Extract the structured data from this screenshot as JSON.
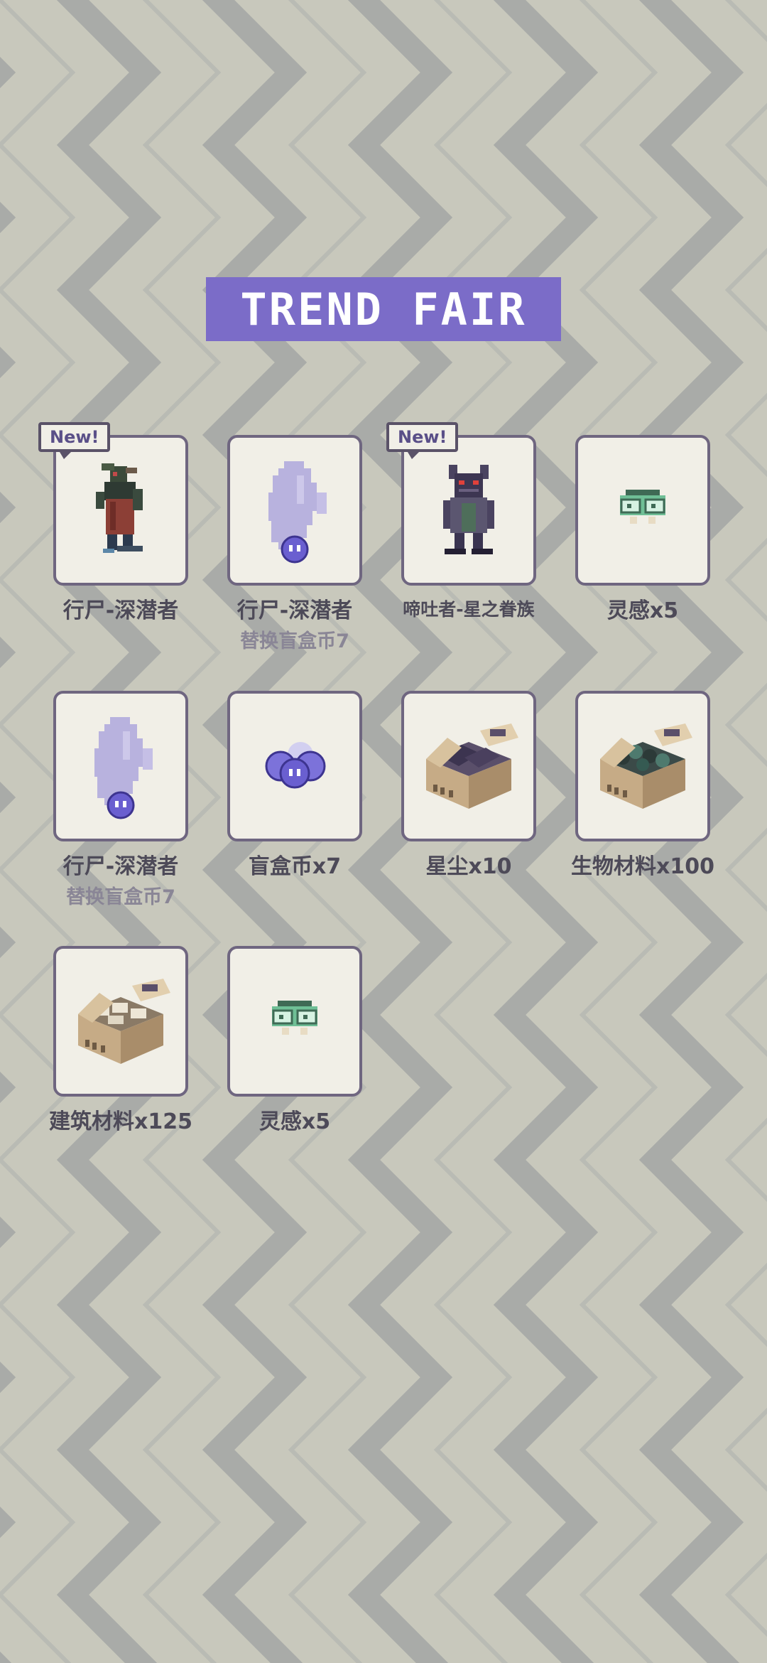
{
  "header": {
    "title": "TREND FAIR"
  },
  "colors": {
    "accent": "#7b6cc8",
    "card_border": "#6f6680",
    "card_bg": "#f1efe7",
    "background": "#c8c8bc",
    "zigzag": "#a9aba8"
  },
  "items": [
    {
      "name": "行尸-深潜者",
      "sub": "",
      "badge": "New!",
      "icon": "zombie-diver-icon"
    },
    {
      "name": "行尸-深潜者",
      "sub": "替换盲盒币7",
      "badge": "",
      "icon": "ghost-silhouette-icon"
    },
    {
      "name": "啼吐者-星之眷族",
      "sub": "",
      "badge": "New!",
      "icon": "star-spawn-icon"
    },
    {
      "name": "灵感x5",
      "sub": "",
      "badge": "",
      "icon": "inspiration-brain-icon"
    },
    {
      "name": "行尸-深潜者",
      "sub": "替换盲盒币7",
      "badge": "",
      "icon": "ghost-silhouette-icon"
    },
    {
      "name": "盲盒币x7",
      "sub": "",
      "badge": "",
      "icon": "blind-box-coin-icon"
    },
    {
      "name": "星尘x10",
      "sub": "",
      "badge": "",
      "icon": "stardust-crate-icon"
    },
    {
      "name": "生物材料x100",
      "sub": "",
      "badge": "",
      "icon": "bio-material-crate-icon"
    },
    {
      "name": "建筑材料x125",
      "sub": "",
      "badge": "",
      "icon": "building-material-crate-icon"
    },
    {
      "name": "灵感x5",
      "sub": "",
      "badge": "",
      "icon": "inspiration-brain-icon"
    }
  ]
}
